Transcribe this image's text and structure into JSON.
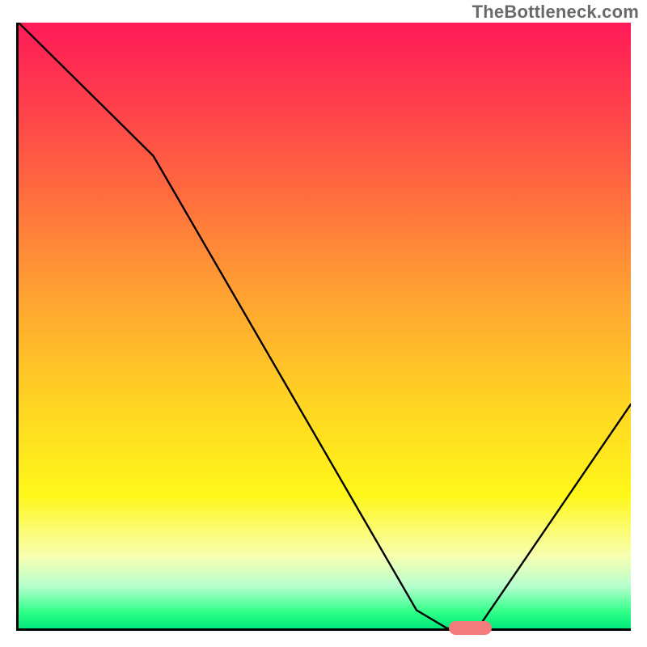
{
  "watermark": "TheBottleneck.com",
  "chart_data": {
    "type": "line",
    "title": "",
    "xlabel": "",
    "ylabel": "",
    "xlim": [
      0,
      100
    ],
    "ylim": [
      0,
      100
    ],
    "grid": false,
    "legend": false,
    "series": [
      {
        "name": "bottleneck-curve",
        "x": [
          0,
          12,
          22,
          65,
          70,
          75,
          100
        ],
        "y": [
          100,
          88,
          78,
          3,
          0,
          0,
          37
        ]
      }
    ],
    "marker": {
      "x_start": 70,
      "x_end": 77,
      "y": 0,
      "color": "#f47c7c"
    },
    "background_gradient": {
      "stops": [
        {
          "pos": 0,
          "color": "#ff1a58"
        },
        {
          "pos": 12,
          "color": "#ff3b4d"
        },
        {
          "pos": 28,
          "color": "#ff6b3e"
        },
        {
          "pos": 45,
          "color": "#ffa232"
        },
        {
          "pos": 62,
          "color": "#ffd223"
        },
        {
          "pos": 78,
          "color": "#fff71a"
        },
        {
          "pos": 88,
          "color": "#f8ffb0"
        },
        {
          "pos": 93,
          "color": "#b8ffcf"
        },
        {
          "pos": 97.5,
          "color": "#2bff86"
        },
        {
          "pos": 100,
          "color": "#00e87b"
        }
      ]
    }
  }
}
